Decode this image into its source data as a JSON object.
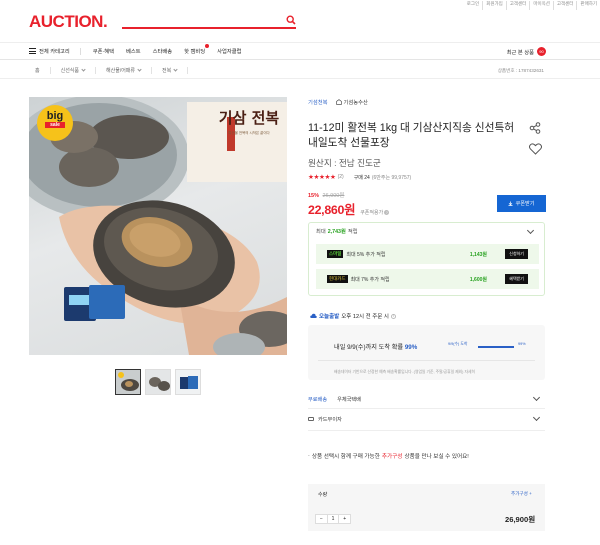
{
  "util_links": [
    "로그인",
    "회원가입",
    "고객센터",
    "마이옥션",
    "고객센터",
    "판매하기"
  ],
  "logo": "AUCTION.",
  "gnb": {
    "all_categories": "전체 카테고리",
    "items": [
      "쿠폰·혜택",
      "베스트",
      "스타배송",
      "핫 캠비딩",
      "사업자클럽"
    ],
    "recent_label": "최근 본 상품",
    "recent_count": "90"
  },
  "breadcrumb": {
    "home": "홈",
    "items": [
      "신선식품",
      "해산물/어패류",
      "전복"
    ],
    "product_no": "상품번호 : 1787432631"
  },
  "product": {
    "seller": "기섬천복",
    "store": "기섬농수산",
    "title": "11-12미 활전복 1kg 대 기삼산지직송 신선특허 내일도착 선물포장",
    "origin": "원산지 : 전남 진도군",
    "stars": "★★★★★",
    "review_count": "(2)",
    "buy_label": "구매 24",
    "buy_sub": "(6만주는 99,9757)",
    "discount_pct": "15%",
    "original_price": "26,900원",
    "price": "22,860원",
    "price_label": "쿠폰적용가",
    "coupon_button": "쿠폰받기",
    "image_label": "기삼 전복",
    "image_sublabel": "특산물 전복의 시작은 끝이다",
    "badge_top": "big",
    "badge_bottom": "sale"
  },
  "reward": {
    "head_prefix": "최대",
    "head_amount": "2,743원",
    "head_suffix": "적립",
    "rows": [
      {
        "badge": "스마일카드",
        "badge_main": "스마일",
        "text": "최대 5% 추가 적립",
        "value": "1,143원",
        "action": "신청하기"
      },
      {
        "badge": "현대카드",
        "badge_main": "현대카드",
        "text": "최대 7% 추가 적립",
        "value": "1,600원",
        "action": "혜택받기"
      }
    ]
  },
  "shipping": {
    "today_label": "오늘출발",
    "cutoff": "오후 12시 전 주문 시",
    "arrive_prefix": "내일 9/9(수)까지 도착 확률",
    "arrive_pct": "99%",
    "bar_label_left": "9/9(수) 도착",
    "bar_label_right": "99%",
    "bar_fraction": 0.99,
    "note": "배송데이터 기반으로 산정한 예측 배송확률입니다. (영업일 기준, 주말/공휴일 제외) 자세히"
  },
  "options": [
    {
      "label": "무료배송",
      "value": "우체국택배"
    },
    {
      "label": "카드무이자",
      "value": ""
    }
  ],
  "notice": {
    "prefix": "상품 선택시 함께 구매 가능한",
    "highlight": "추가구성",
    "suffix": "상품을 만나 보실 수 있어요!"
  },
  "quantity": {
    "label": "수량",
    "add_label": "추가구성 +",
    "minus": "−",
    "value": "1",
    "plus": "+",
    "total": "26,900원"
  },
  "colors": {
    "brand_red": "#e8212c",
    "accent_blue": "#1566d3",
    "reward_green": "#26a11e"
  }
}
